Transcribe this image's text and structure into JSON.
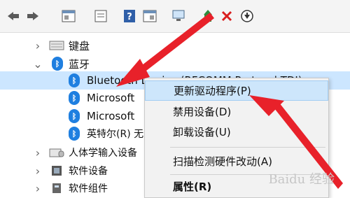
{
  "toolbar": {
    "icons": [
      "back-icon",
      "forward-icon",
      "properties-icon",
      "show-hidden-icon",
      "help-icon",
      "update-driver-icon",
      "scan-hardware-icon",
      "add-hardware-icon",
      "uninstall-icon",
      "disable-icon"
    ]
  },
  "tree": {
    "keyboard_label": "键盘",
    "bluetooth_label": "蓝牙",
    "children": [
      {
        "label": "Bluetooth Device (RFCOMM Protocol TDI)"
      },
      {
        "label": "Microsoft"
      },
      {
        "label": "Microsoft"
      },
      {
        "label": "英特尔(R) 无"
      }
    ],
    "hid_label": "人体学输入设备",
    "software_device_label": "软件设备",
    "software_component_label": "软件组件"
  },
  "context_menu": {
    "items": [
      {
        "label": "更新驱动程序(P)",
        "highlighted": true
      },
      {
        "label": "禁用设备(D)"
      },
      {
        "label": "卸载设备(U)"
      },
      {
        "label": "扫描检测硬件改动(A)"
      },
      {
        "label": "属性(R)",
        "bold": true
      }
    ]
  },
  "watermark": "Baidu 经验",
  "colors": {
    "bluetooth": "#1f7fe0",
    "arrow": "#e8212a",
    "highlight": "#cde6fb"
  }
}
